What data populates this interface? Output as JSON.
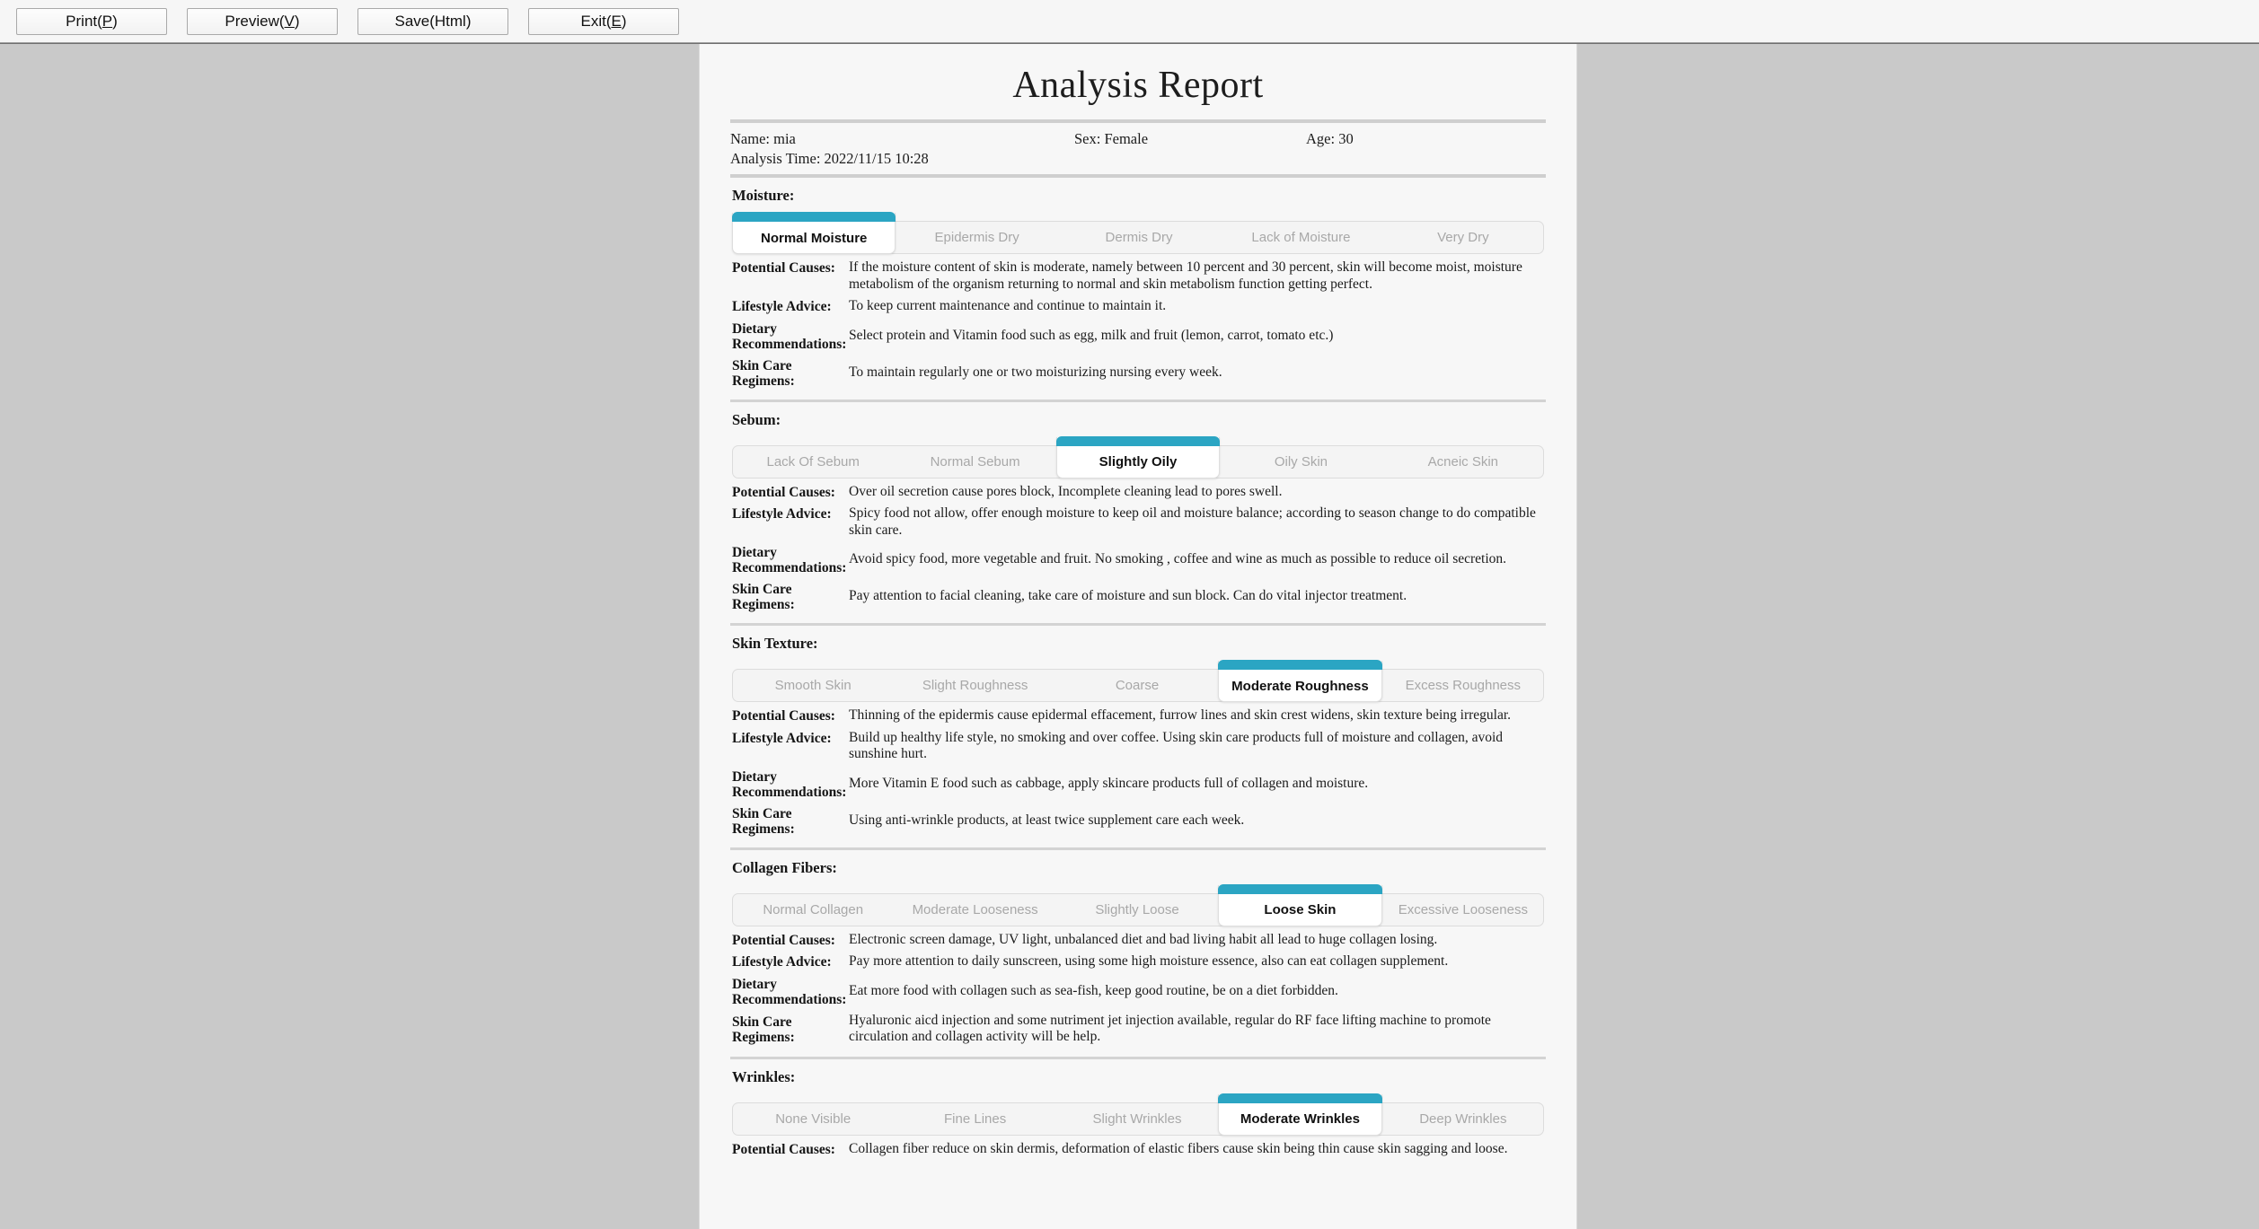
{
  "toolbar": {
    "buttons": [
      {
        "name": "print",
        "pre": "Print(",
        "mnemonic": "P",
        "post": ")"
      },
      {
        "name": "preview",
        "pre": "Preview(",
        "mnemonic": "V",
        "post": ")"
      },
      {
        "name": "save",
        "pre": "Save(Html",
        "mnemonic": "",
        "post": ")"
      },
      {
        "name": "exit",
        "pre": "Exit(",
        "mnemonic": "E",
        "post": ")"
      }
    ]
  },
  "report": {
    "title": "Analysis Report",
    "patient": {
      "name": "Name: mia",
      "sex": "Sex: Female",
      "age": "Age: 30",
      "analysis_time": "Analysis Time: 2022/11/15 10:28"
    },
    "labels": {
      "potential_causes": "Potential Causes:",
      "lifestyle_advice": "Lifestyle Advice:",
      "dietary_recommendations": "Dietary Recommendations:",
      "skin_care_regimens": "Skin Care Regimens:"
    },
    "accent_color": "#2ba5c3",
    "sections": [
      {
        "key": "moisture",
        "title": "Moisture:",
        "tabs": [
          "Normal Moisture",
          "Epidermis Dry",
          "Dermis Dry",
          "Lack of Moisture",
          "Very Dry"
        ],
        "active_index": 0,
        "potential_causes": "If the moisture content of skin is moderate, namely between 10 percent and 30 percent, skin will become moist, moisture metabolism of the organism returning to normal and skin metabolism function getting perfect.",
        "lifestyle_advice": "To keep current maintenance and continue to maintain it.",
        "dietary_recommendations": "Select protein and Vitamin food such as egg, milk and fruit (lemon, carrot, tomato etc.)",
        "skin_care_regimens": "To maintain regularly one or two moisturizing nursing every week."
      },
      {
        "key": "sebum",
        "title": "Sebum:",
        "tabs": [
          "Lack Of Sebum",
          "Normal Sebum",
          "Slightly Oily",
          "Oily Skin",
          "Acneic Skin"
        ],
        "active_index": 2,
        "potential_causes": "Over oil secretion cause pores block, Incomplete cleaning lead to pores swell.",
        "lifestyle_advice": "Spicy food not allow, offer enough moisture to keep oil and moisture balance; according to season change to do compatible skin care.",
        "dietary_recommendations": "Avoid spicy food, more vegetable and fruit. No smoking , coffee and wine as much as possible to reduce oil secretion.",
        "skin_care_regimens": "Pay attention to facial cleaning, take care of moisture and sun block. Can do vital injector treatment."
      },
      {
        "key": "skin-texture",
        "title": "Skin Texture:",
        "tabs": [
          "Smooth Skin",
          "Slight Roughness",
          "Coarse",
          "Moderate Roughness",
          "Excess Roughness"
        ],
        "active_index": 3,
        "potential_causes": "Thinning of the epidermis cause epidermal effacement, furrow lines and skin crest widens, skin texture being irregular.",
        "lifestyle_advice": "Build up healthy life style, no smoking and over coffee. Using skin care products full of moisture and collagen, avoid sunshine hurt.",
        "dietary_recommendations": "More Vitamin E food such as cabbage, apply skincare products full of collagen and moisture.",
        "skin_care_regimens": "Using anti-wrinkle products, at least twice supplement care each week."
      },
      {
        "key": "collagen-fibers",
        "title": "Collagen Fibers:",
        "tabs": [
          "Normal Collagen",
          "Moderate Looseness",
          "Slightly Loose",
          "Loose Skin",
          "Excessive Looseness"
        ],
        "active_index": 3,
        "potential_causes": "Electronic screen damage, UV light, unbalanced diet and bad living habit all lead to huge collagen losing.",
        "lifestyle_advice": "Pay more attention to daily sunscreen, using some high moisture essence, also can eat collagen supplement.",
        "dietary_recommendations": "Eat more food with collagen such as sea-fish, keep good routine, be on a diet forbidden.",
        "skin_care_regimens": "Hyaluronic aicd injection and some nutriment jet injection available, regular do RF face lifting machine to promote circulation and collagen activity will be help."
      },
      {
        "key": "wrinkles",
        "title": "Wrinkles:",
        "tabs": [
          "None Visible",
          "Fine Lines",
          "Slight Wrinkles",
          "Moderate Wrinkles",
          "Deep Wrinkles"
        ],
        "active_index": 3,
        "potential_causes": "Collagen fiber reduce on skin dermis, deformation of elastic fibers cause skin being thin cause skin sagging and loose.",
        "lifestyle_advice": "",
        "dietary_recommendations": "",
        "skin_care_regimens": ""
      }
    ]
  }
}
